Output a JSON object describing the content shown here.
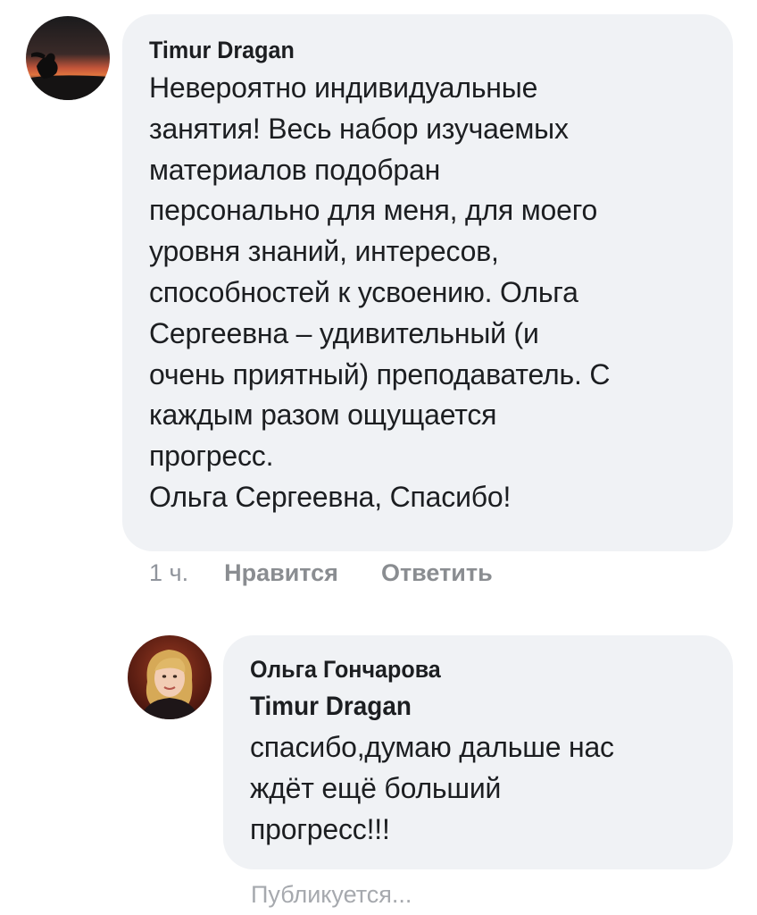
{
  "comment": {
    "author": "Timur Dragan",
    "lines": [
      "Невероятно индивидуальные",
      "занятия! Весь набор изучаемых",
      "материалов подобран",
      "персонально для меня, для моего",
      "уровня знаний, интересов,",
      "способностей к усвоению. Ольга",
      "Сергеевна – удивительный (и",
      "очень приятный) преподаватель. С",
      "каждым разом ощущается",
      "прогресс.",
      "Ольга Сергеевна, Спасибо!"
    ],
    "time": "1 ч.",
    "like_label": "Нравится",
    "reply_label": "Ответить"
  },
  "reply": {
    "author": "Ольга Гончарова",
    "mention": "Timur Dragan",
    "lines": [
      "спасибо,думаю дальше нас",
      "ждёт ещё больший",
      "прогресс!!!"
    ],
    "status": "Публикуется..."
  },
  "colors": {
    "bubble_bg": "#f0f2f5",
    "text": "#1c1e21",
    "meta": "#8a8d91"
  }
}
